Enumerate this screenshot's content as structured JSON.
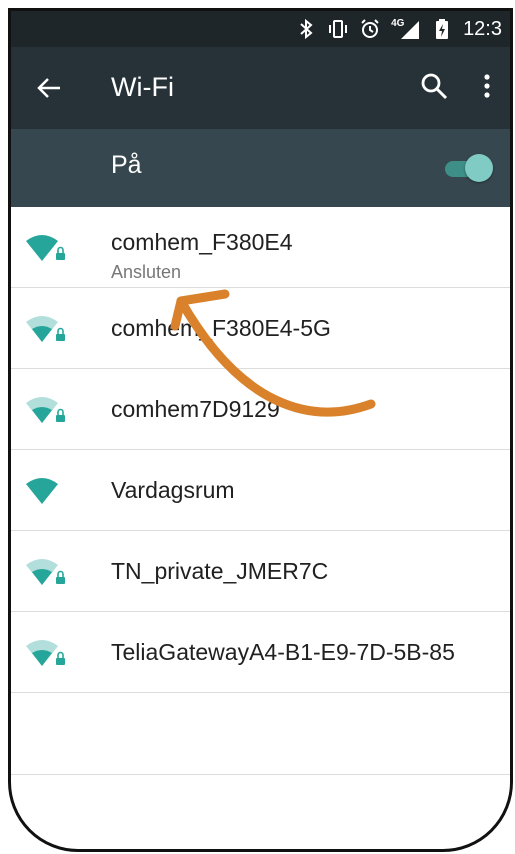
{
  "status_bar": {
    "time": "12:3",
    "network": "4G",
    "icons": [
      "bluetooth-icon",
      "vibrate-icon",
      "alarm-icon",
      "signal-icon",
      "battery-charging-icon"
    ]
  },
  "app_bar": {
    "title": "Wi-Fi",
    "back_icon": "arrow-back-icon",
    "search_icon": "search-icon",
    "more_icon": "more-vert-icon"
  },
  "wifi_toggle": {
    "label": "På",
    "state": "on",
    "accent": "#80cbc4"
  },
  "networks": [
    {
      "ssid": "comhem_F380E4",
      "status": "Ansluten",
      "secured": true,
      "signal": "full"
    },
    {
      "ssid": "comhem_F380E4-5G",
      "status": "",
      "secured": true,
      "signal": "weak"
    },
    {
      "ssid": "comhem7D9129",
      "status": "",
      "secured": true,
      "signal": "weak"
    },
    {
      "ssid": "Vardagsrum",
      "status": "",
      "secured": false,
      "signal": "full"
    },
    {
      "ssid": "TN_private_JMER7C",
      "status": "",
      "secured": true,
      "signal": "weak"
    },
    {
      "ssid": "TeliaGatewayA4-B1-E9-7D-5B-85",
      "status": "",
      "secured": true,
      "signal": "weak"
    }
  ],
  "colors": {
    "status_bar": "#1f2629",
    "app_bar": "#263238",
    "toggle_bar": "#37474f",
    "wifi_icon": "#26a69a",
    "wifi_icon_faded": "#b2dfdb",
    "annotation_arrow": "#d9822b"
  }
}
